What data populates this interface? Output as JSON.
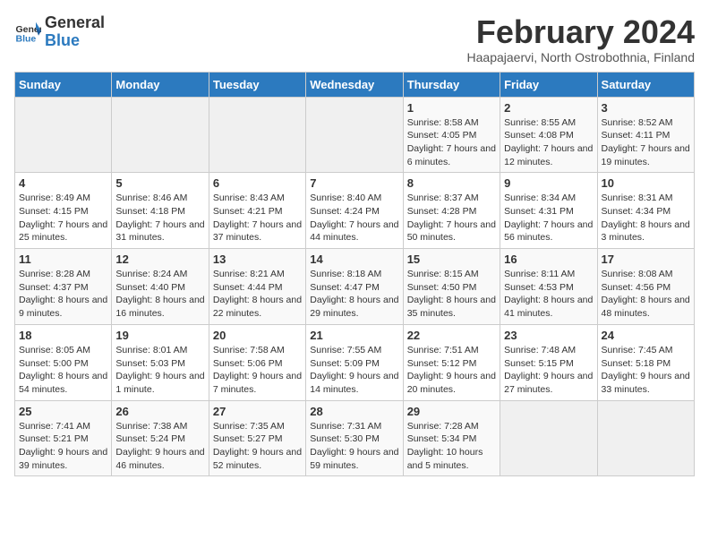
{
  "app": {
    "name_general": "General",
    "name_blue": "Blue"
  },
  "title": "February 2024",
  "subtitle": "Haapajaervi, North Ostrobothnia, Finland",
  "weekdays": [
    "Sunday",
    "Monday",
    "Tuesday",
    "Wednesday",
    "Thursday",
    "Friday",
    "Saturday"
  ],
  "weeks": [
    [
      {
        "day": "",
        "info": ""
      },
      {
        "day": "",
        "info": ""
      },
      {
        "day": "",
        "info": ""
      },
      {
        "day": "",
        "info": ""
      },
      {
        "day": "1",
        "info": "Sunrise: 8:58 AM\nSunset: 4:05 PM\nDaylight: 7 hours\nand 6 minutes."
      },
      {
        "day": "2",
        "info": "Sunrise: 8:55 AM\nSunset: 4:08 PM\nDaylight: 7 hours\nand 12 minutes."
      },
      {
        "day": "3",
        "info": "Sunrise: 8:52 AM\nSunset: 4:11 PM\nDaylight: 7 hours\nand 19 minutes."
      }
    ],
    [
      {
        "day": "4",
        "info": "Sunrise: 8:49 AM\nSunset: 4:15 PM\nDaylight: 7 hours\nand 25 minutes."
      },
      {
        "day": "5",
        "info": "Sunrise: 8:46 AM\nSunset: 4:18 PM\nDaylight: 7 hours\nand 31 minutes."
      },
      {
        "day": "6",
        "info": "Sunrise: 8:43 AM\nSunset: 4:21 PM\nDaylight: 7 hours\nand 37 minutes."
      },
      {
        "day": "7",
        "info": "Sunrise: 8:40 AM\nSunset: 4:24 PM\nDaylight: 7 hours\nand 44 minutes."
      },
      {
        "day": "8",
        "info": "Sunrise: 8:37 AM\nSunset: 4:28 PM\nDaylight: 7 hours\nand 50 minutes."
      },
      {
        "day": "9",
        "info": "Sunrise: 8:34 AM\nSunset: 4:31 PM\nDaylight: 7 hours\nand 56 minutes."
      },
      {
        "day": "10",
        "info": "Sunrise: 8:31 AM\nSunset: 4:34 PM\nDaylight: 8 hours\nand 3 minutes."
      }
    ],
    [
      {
        "day": "11",
        "info": "Sunrise: 8:28 AM\nSunset: 4:37 PM\nDaylight: 8 hours\nand 9 minutes."
      },
      {
        "day": "12",
        "info": "Sunrise: 8:24 AM\nSunset: 4:40 PM\nDaylight: 8 hours\nand 16 minutes."
      },
      {
        "day": "13",
        "info": "Sunrise: 8:21 AM\nSunset: 4:44 PM\nDaylight: 8 hours\nand 22 minutes."
      },
      {
        "day": "14",
        "info": "Sunrise: 8:18 AM\nSunset: 4:47 PM\nDaylight: 8 hours\nand 29 minutes."
      },
      {
        "day": "15",
        "info": "Sunrise: 8:15 AM\nSunset: 4:50 PM\nDaylight: 8 hours\nand 35 minutes."
      },
      {
        "day": "16",
        "info": "Sunrise: 8:11 AM\nSunset: 4:53 PM\nDaylight: 8 hours\nand 41 minutes."
      },
      {
        "day": "17",
        "info": "Sunrise: 8:08 AM\nSunset: 4:56 PM\nDaylight: 8 hours\nand 48 minutes."
      }
    ],
    [
      {
        "day": "18",
        "info": "Sunrise: 8:05 AM\nSunset: 5:00 PM\nDaylight: 8 hours\nand 54 minutes."
      },
      {
        "day": "19",
        "info": "Sunrise: 8:01 AM\nSunset: 5:03 PM\nDaylight: 9 hours\nand 1 minute."
      },
      {
        "day": "20",
        "info": "Sunrise: 7:58 AM\nSunset: 5:06 PM\nDaylight: 9 hours\nand 7 minutes."
      },
      {
        "day": "21",
        "info": "Sunrise: 7:55 AM\nSunset: 5:09 PM\nDaylight: 9 hours\nand 14 minutes."
      },
      {
        "day": "22",
        "info": "Sunrise: 7:51 AM\nSunset: 5:12 PM\nDaylight: 9 hours\nand 20 minutes."
      },
      {
        "day": "23",
        "info": "Sunrise: 7:48 AM\nSunset: 5:15 PM\nDaylight: 9 hours\nand 27 minutes."
      },
      {
        "day": "24",
        "info": "Sunrise: 7:45 AM\nSunset: 5:18 PM\nDaylight: 9 hours\nand 33 minutes."
      }
    ],
    [
      {
        "day": "25",
        "info": "Sunrise: 7:41 AM\nSunset: 5:21 PM\nDaylight: 9 hours\nand 39 minutes."
      },
      {
        "day": "26",
        "info": "Sunrise: 7:38 AM\nSunset: 5:24 PM\nDaylight: 9 hours\nand 46 minutes."
      },
      {
        "day": "27",
        "info": "Sunrise: 7:35 AM\nSunset: 5:27 PM\nDaylight: 9 hours\nand 52 minutes."
      },
      {
        "day": "28",
        "info": "Sunrise: 7:31 AM\nSunset: 5:30 PM\nDaylight: 9 hours\nand 59 minutes."
      },
      {
        "day": "29",
        "info": "Sunrise: 7:28 AM\nSunset: 5:34 PM\nDaylight: 10 hours\nand 5 minutes."
      },
      {
        "day": "",
        "info": ""
      },
      {
        "day": "",
        "info": ""
      }
    ]
  ]
}
